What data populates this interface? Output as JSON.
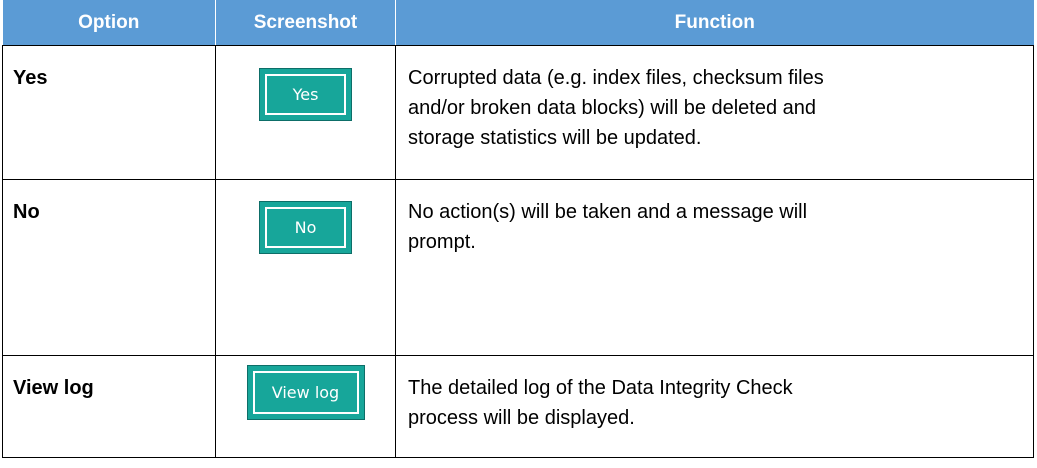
{
  "headers": {
    "option": "Option",
    "screenshot": "Screenshot",
    "function": "Function"
  },
  "rows": [
    {
      "option": "Yes",
      "button_label": "Yes",
      "function_lines": [
        "Corrupted data (e.g. index files, checksum files",
        "and/or broken data blocks) will be deleted and",
        "storage statistics will be updated."
      ]
    },
    {
      "option": "No",
      "button_label": "No",
      "function_lines": [
        "No action(s) will be taken and a message will",
        "prompt."
      ]
    },
    {
      "option": "View log",
      "button_label": "View log",
      "function_lines": [
        "The detailed log of the Data Integrity Check",
        "process will be displayed."
      ]
    }
  ],
  "colors": {
    "header_bg": "#5b9bd5",
    "button_bg": "#17a69a"
  }
}
